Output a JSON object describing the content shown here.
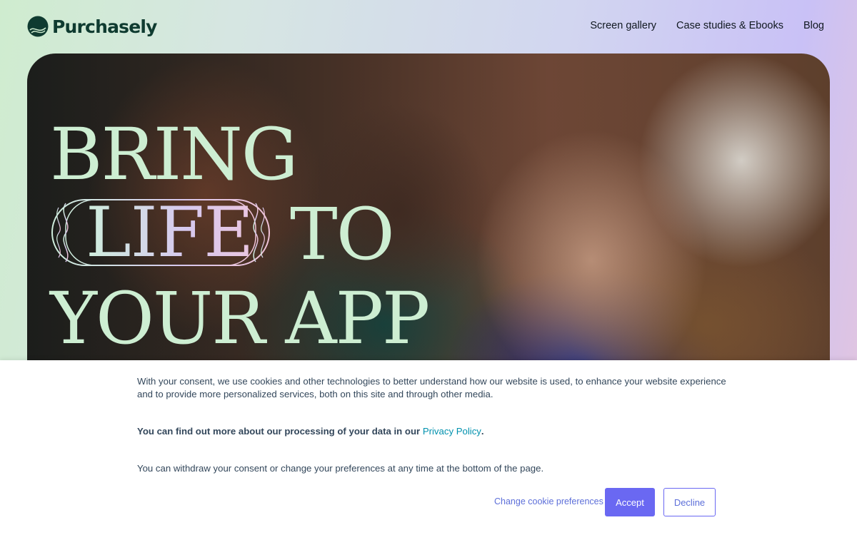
{
  "brand": {
    "name": "Purchasely",
    "logo_icon": "purchasely-logo-icon",
    "color": "#0f3b30"
  },
  "nav": {
    "items": [
      {
        "label": "Screen gallery"
      },
      {
        "label": "Case studies & Ebooks"
      },
      {
        "label": "Blog"
      }
    ]
  },
  "hero": {
    "line1": "BRING",
    "highlight": "LIFE",
    "line2_rest": "TO",
    "line3": "YOUR APP",
    "text_color": "#cdeed2"
  },
  "consent": {
    "paragraph1": "With your consent, we use cookies and other technologies to better understand how our website is used, to enhance your website experience and to provide more personalized services, both on this site and through other media.",
    "paragraph2_prefix": "You can find out more about our processing of your data in our",
    "privacy_link": "Privacy Policy",
    "paragraph2_suffix": ".",
    "paragraph3": "You can withdraw your consent or change your preferences at any time at the bottom of the page.",
    "prefs_label": "Change cookie preferences",
    "accept_label": "Accept",
    "decline_label": "Decline",
    "accent_color": "#6a68f2"
  }
}
